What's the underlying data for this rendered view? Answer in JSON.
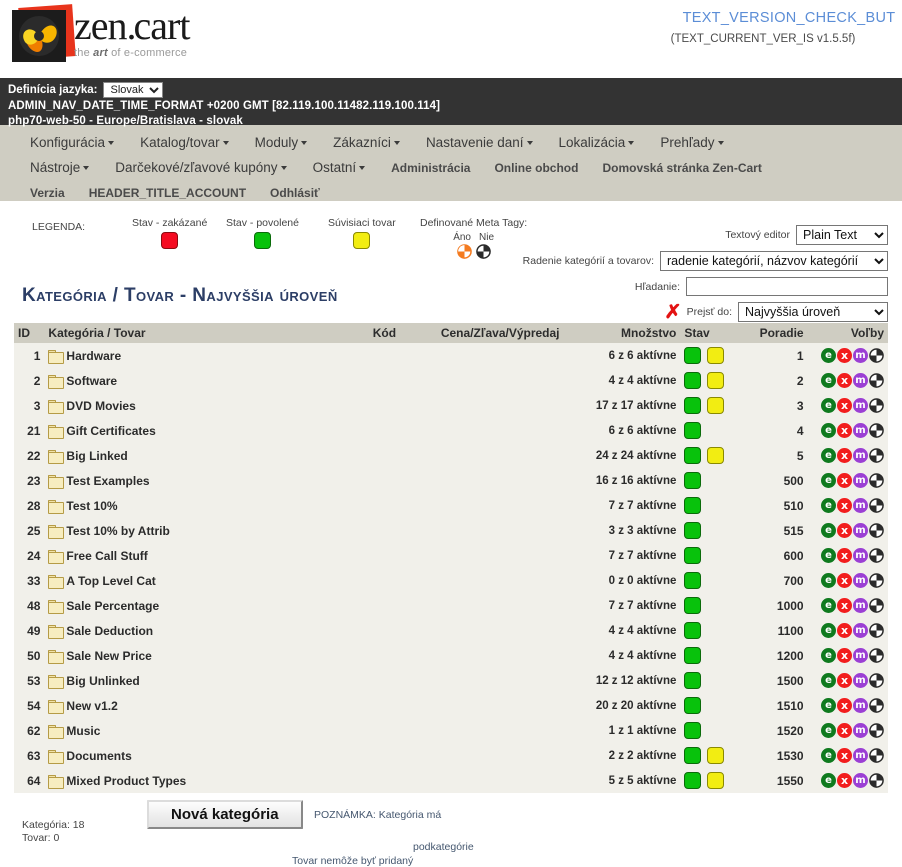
{
  "header": {
    "logo_zen": "zen",
    "logo_cart": "cart",
    "logo_tagline_pre": "the ",
    "logo_tagline_art": "art",
    "logo_tagline_post": " of e-commerce",
    "version_check_label": "TEXT_VERSION_CHECK_BUT",
    "current_version": "(TEXT_CURRENT_VER_IS v1.5.5f)"
  },
  "info_bar": {
    "language_label": "Definícia jazyka:",
    "language_selected": "Slovak",
    "language_options": [
      "Slovak"
    ],
    "datetime_line": "ADMIN_NAV_DATE_TIME_FORMAT +0200 GMT [82.119.100.11482.119.100.114]",
    "server_line": "php70-web-50 - Europe/Bratislava - slovak"
  },
  "nav": {
    "row1": [
      {
        "label": "Konfigurácia",
        "caret": true
      },
      {
        "label": "Katalog/tovar",
        "caret": true
      },
      {
        "label": "Moduly",
        "caret": true
      },
      {
        "label": "Zákazníci",
        "caret": true
      },
      {
        "label": "Nastavenie daní",
        "caret": true
      },
      {
        "label": "Lokalizácia",
        "caret": true
      },
      {
        "label": "Prehľady",
        "caret": true
      }
    ],
    "row2": [
      {
        "label": "Nástroje",
        "caret": true
      },
      {
        "label": "Darčekové/zľavové kupóny",
        "caret": true
      },
      {
        "label": "Ostatní",
        "caret": true
      },
      {
        "label": "Administrácia",
        "caret": false
      },
      {
        "label": "Online obchod",
        "caret": false
      },
      {
        "label": "Domovská stránka Zen-Cart",
        "caret": false
      }
    ],
    "row3": [
      {
        "label": "Verzia",
        "caret": false
      },
      {
        "label": "HEADER_TITLE_ACCOUNT",
        "caret": false
      },
      {
        "label": "Odhlásiť",
        "caret": false
      }
    ]
  },
  "legend": {
    "title": "LEGENDA:",
    "items": [
      {
        "label": "Stav - zakázané",
        "color": "red"
      },
      {
        "label": "Stav - povolené",
        "color": "green"
      },
      {
        "label": "Súvisiaci tovar",
        "color": "yellow"
      }
    ],
    "meta": {
      "label": "Definované Meta Tagy:",
      "yes": "Áno",
      "no": "Nie"
    },
    "colors": {
      "red": "#f50b21",
      "green": "#08c20c",
      "yellow": "#f2ed12",
      "meta_yes": "#f47b20",
      "meta_no": "#2b2b2b"
    }
  },
  "controls": {
    "editor_label": "Textový editor",
    "editor_selected": "Plain Text",
    "editor_options": [
      "Plain Text"
    ],
    "sort_label": "Radenie kategórií a tovarov:",
    "sort_selected": "radenie kategórií, názvov kategórií",
    "sort_options": [
      "radenie kategórií, názvov kategórií"
    ],
    "search_label": "Hľadanie:",
    "search_value": "",
    "search_placeholder": "",
    "jump_label": "Prejsť do:",
    "jump_selected": "Najvyššia úroveň",
    "jump_options": [
      "Najvyššia úroveň"
    ],
    "reset_icon": "✗"
  },
  "page_title": "Kategória / Tovar - Najvyššia úroveň",
  "table": {
    "headers": {
      "id": "ID",
      "name": "Kategória / Tovar",
      "code": "Kód",
      "price": "Cena/Zľava/Výpredaj",
      "qty": "Množstvo",
      "status": "Stav",
      "order": "Poradie",
      "actions": "Voľby"
    },
    "rows": [
      {
        "id": "1",
        "name": "Hardware",
        "code": "",
        "price": "",
        "qty": "6 z 6 aktívne",
        "status": [
          "green",
          "yellow"
        ],
        "order": "1"
      },
      {
        "id": "2",
        "name": "Software",
        "code": "",
        "price": "",
        "qty": "4 z 4 aktívne",
        "status": [
          "green",
          "yellow"
        ],
        "order": "2"
      },
      {
        "id": "3",
        "name": "DVD Movies",
        "code": "",
        "price": "",
        "qty": "17 z 17 aktívne",
        "status": [
          "green",
          "yellow"
        ],
        "order": "3"
      },
      {
        "id": "21",
        "name": "Gift Certificates",
        "code": "",
        "price": "",
        "qty": "6 z 6 aktívne",
        "status": [
          "green"
        ],
        "order": "4"
      },
      {
        "id": "22",
        "name": "Big Linked",
        "code": "",
        "price": "",
        "qty": "24 z 24 aktívne",
        "status": [
          "green",
          "yellow"
        ],
        "order": "5"
      },
      {
        "id": "23",
        "name": "Test Examples",
        "code": "",
        "price": "",
        "qty": "16 z 16 aktívne",
        "status": [
          "green"
        ],
        "order": "500"
      },
      {
        "id": "28",
        "name": "Test 10%",
        "code": "",
        "price": "",
        "qty": "7 z 7 aktívne",
        "status": [
          "green"
        ],
        "order": "510"
      },
      {
        "id": "25",
        "name": "Test 10% by Attrib",
        "code": "",
        "price": "",
        "qty": "3 z 3 aktívne",
        "status": [
          "green"
        ],
        "order": "515"
      },
      {
        "id": "24",
        "name": "Free Call Stuff",
        "code": "",
        "price": "",
        "qty": "7 z 7 aktívne",
        "status": [
          "green"
        ],
        "order": "600"
      },
      {
        "id": "33",
        "name": "A Top Level Cat",
        "code": "",
        "price": "",
        "qty": "0 z 0 aktívne",
        "status": [
          "green"
        ],
        "order": "700"
      },
      {
        "id": "48",
        "name": "Sale Percentage",
        "code": "",
        "price": "",
        "qty": "7 z 7 aktívne",
        "status": [
          "green"
        ],
        "order": "1000"
      },
      {
        "id": "49",
        "name": "Sale Deduction",
        "code": "",
        "price": "",
        "qty": "4 z 4 aktívne",
        "status": [
          "green"
        ],
        "order": "1100"
      },
      {
        "id": "50",
        "name": "Sale New Price",
        "code": "",
        "price": "",
        "qty": "4 z 4 aktívne",
        "status": [
          "green"
        ],
        "order": "1200"
      },
      {
        "id": "53",
        "name": "Big Unlinked",
        "code": "",
        "price": "",
        "qty": "12 z 12 aktívne",
        "status": [
          "green"
        ],
        "order": "1500"
      },
      {
        "id": "54",
        "name": "New v1.2",
        "code": "",
        "price": "",
        "qty": "20 z 20 aktívne",
        "status": [
          "green"
        ],
        "order": "1510"
      },
      {
        "id": "62",
        "name": "Music",
        "code": "",
        "price": "",
        "qty": "1 z 1 aktívne",
        "status": [
          "green"
        ],
        "order": "1520"
      },
      {
        "id": "63",
        "name": "Documents",
        "code": "",
        "price": "",
        "qty": "2 z 2 aktívne",
        "status": [
          "green",
          "yellow"
        ],
        "order": "1530"
      },
      {
        "id": "64",
        "name": "Mixed Product Types",
        "code": "",
        "price": "",
        "qty": "5 z 5 aktívne",
        "status": [
          "green",
          "yellow"
        ],
        "order": "1550"
      }
    ],
    "action_icons": [
      "edit",
      "delete",
      "move",
      "meta-tags"
    ],
    "action_labels": {
      "edit": "e",
      "delete": "x",
      "move": "m"
    }
  },
  "footer": {
    "new_category_button": "Nová kategória",
    "count_categories": "Kategória: 18",
    "count_products": "Tovar: 0",
    "note_line1": "POZNÁMKA: Kategória má",
    "note_line2": "podkategórie",
    "note_line3": "Tovar nemôže byť pridaný"
  }
}
